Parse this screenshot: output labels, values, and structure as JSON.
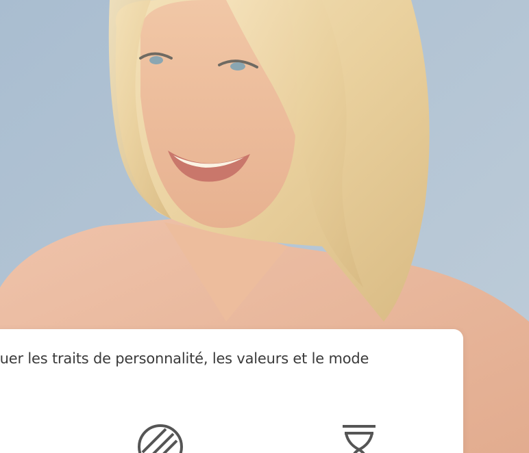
{
  "card": {
    "text": "luer les traits de personnalité, les valeurs et le mode"
  },
  "icons": {
    "first": "slashed-circle-icon",
    "second": "hourglass-icon"
  },
  "colors": {
    "background": "#b3c3d3",
    "card": "#ffffff",
    "text": "#3a3a3a",
    "icon_stroke": "#555555",
    "blouse": "#e9b89d"
  }
}
